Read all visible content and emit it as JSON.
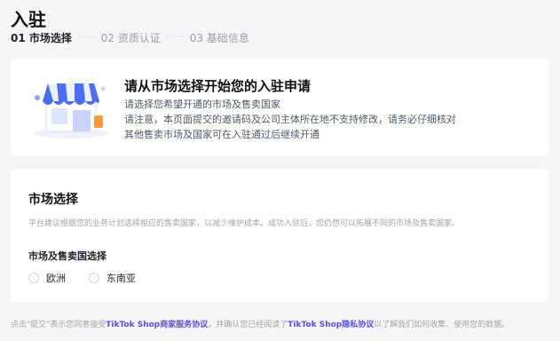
{
  "page": {
    "title": "入驻"
  },
  "steps": [
    {
      "label": "01 市场选择",
      "active": true
    },
    {
      "label": "02 资质认证",
      "active": false
    },
    {
      "label": "03 基础信息",
      "active": false
    }
  ],
  "steps_separator": "·····",
  "intro": {
    "title": "请从市场选择开始您的入驻申请",
    "line1": "请选择您希望开通的市场及售卖国家",
    "line2": "请注意，本页面提交的邀请码及公司主体所在地不支持修改，请务必仔细核对",
    "line3": "其他售卖市场及国家可在入驻通过后继续开通",
    "illustration_icon": "storefront-icon"
  },
  "market": {
    "title": "市场选择",
    "description": "平台建议根据您的业务计划选择相应的售卖国家，以减少维护成本。成功入驻后，您仍然可以拓展不同的市场及售卖国家。",
    "field_label": "市场及售卖国选择",
    "options": [
      {
        "label": "欧洲",
        "selected": false
      },
      {
        "label": "东南亚",
        "selected": false
      }
    ]
  },
  "footer": {
    "prefix": "点击\"提交\"表示您同意接受",
    "link1": "TikTok Shop商家服务协议",
    "middle": "，并确认您已经阅读了",
    "link2": "TikTok Shop隐私协议",
    "suffix": "以了解我们如何收集、使用您的数据。"
  },
  "colors": {
    "accent": "#5b4fe0",
    "background": "#f5f6f8",
    "card": "#ffffff",
    "awning_blue": "#4a6ef5"
  }
}
